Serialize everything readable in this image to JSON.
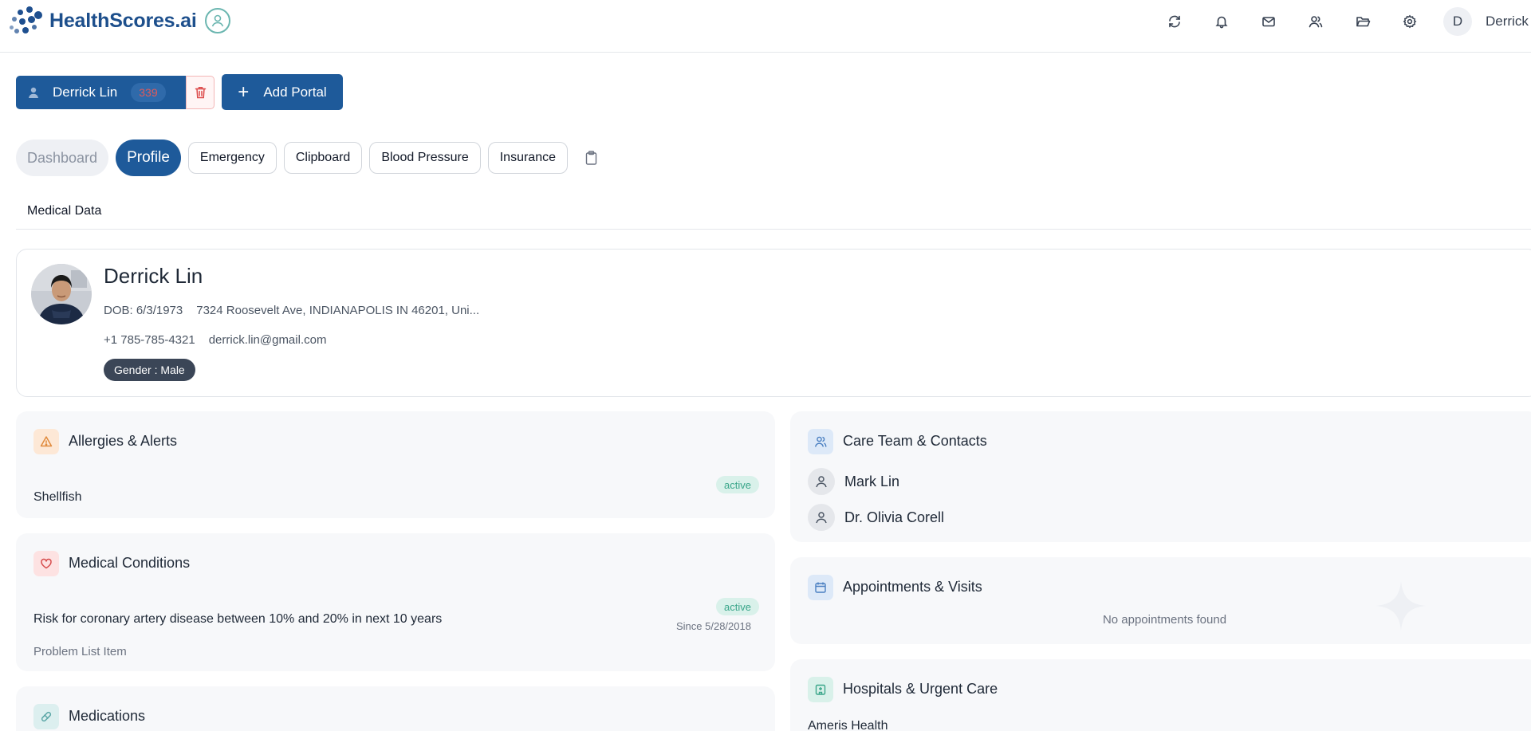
{
  "app": {
    "name": "HealthScores.ai"
  },
  "topbar": {
    "icons": [
      "refresh-icon",
      "bell-icon",
      "mail-icon",
      "users-icon",
      "folder-icon",
      "gear-icon"
    ],
    "avatar_initial": "D",
    "user_name": "Derrick"
  },
  "patient": {
    "name": "Derrick Lin",
    "count": "339",
    "add_portal_label": "Add Portal"
  },
  "tabs": [
    {
      "label": "Dashboard",
      "state": "disabled"
    },
    {
      "label": "Profile",
      "state": "active"
    },
    {
      "label": "Emergency",
      "state": "normal"
    },
    {
      "label": "Clipboard",
      "state": "normal"
    },
    {
      "label": "Blood Pressure",
      "state": "normal"
    },
    {
      "label": "Insurance",
      "state": "normal"
    }
  ],
  "section_label": "Medical Data",
  "profile": {
    "name": "Derrick Lin",
    "dob": "DOB: 6/3/1973",
    "address": "7324 Roosevelt Ave, INDIANAPOLIS IN 46201, Uni...",
    "phone": "+1 785-785-4321",
    "email": "derrick.lin@gmail.com",
    "gender": "Gender : Male"
  },
  "allergies": {
    "title": "Allergies & Alerts",
    "item": "Shellfish",
    "status": "active"
  },
  "conditions": {
    "title": "Medical Conditions",
    "item": "Risk for coronary artery disease between 10% and 20% in next 10 years",
    "status": "active",
    "since": "Since 5/28/2018",
    "category": "Problem List Item"
  },
  "medications": {
    "title": "Medications"
  },
  "care_team": {
    "title": "Care Team & Contacts",
    "contacts": [
      "Mark Lin",
      "Dr. Olivia Corell"
    ]
  },
  "appointments": {
    "title": "Appointments & Visits",
    "empty": "No appointments found"
  },
  "hospitals": {
    "title": "Hospitals & Urgent Care",
    "first": "Ameris Health"
  },
  "colors": {
    "brand": "#1e5a9a",
    "active_badge_bg": "#d9f1ea",
    "active_badge_text": "#3aa68a"
  }
}
